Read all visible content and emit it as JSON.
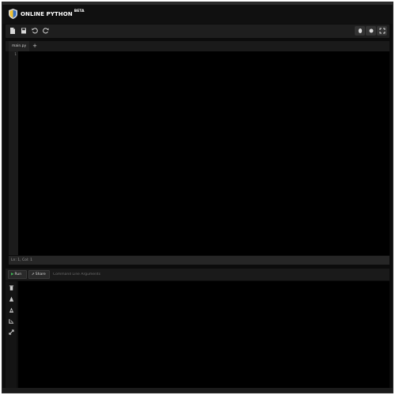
{
  "header": {
    "logo_text": "ONLINE PYTHON",
    "logo_badge": "BETA"
  },
  "toolbar": {
    "left_icons": [
      "file-icon",
      "save-icon",
      "undo-icon",
      "redo-icon"
    ],
    "right_icons": [
      "upload-icon",
      "download-icon",
      "fullscreen-icon"
    ]
  },
  "tabs": [
    {
      "label": "main.py"
    }
  ],
  "tab_add_label": "+",
  "editor": {
    "line_numbers": [
      "1"
    ]
  },
  "status": {
    "cursor": "Ln: 1, Col: 1"
  },
  "runbar": {
    "run_label": "Run",
    "share_label": "Share",
    "args_placeholder": "Command Line Arguments"
  },
  "console_tools": [
    "clear-icon",
    "copy-icon",
    "paste-icon",
    "font-size-icon",
    "expand-icon"
  ],
  "colors": {
    "background": "#000000",
    "panel": "#1e1e1e",
    "run_green": "#3fbf55",
    "logo_yellow": "#f2c230",
    "logo_blue": "#3a72c4"
  }
}
